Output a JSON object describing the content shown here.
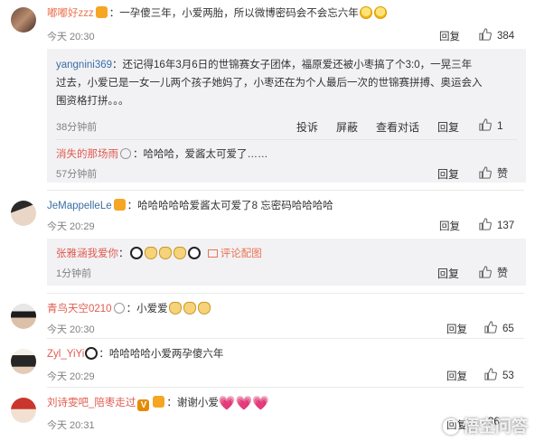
{
  "c1": {
    "user": "嘟嘟好zzz",
    "text": "：一孕傻三年，小爱两胎，所以微博密码会不会忘六年",
    "time": "今天 20:30",
    "reply": "回复",
    "likes": "384",
    "sub": {
      "r1": {
        "user": "yangnini369",
        "line1": "：还记得16年3月6日的世锦赛女子团体，福原爱还被小枣搞了个3:0，一晃三年",
        "line2": "过去，小爱已是一女一儿两个孩子她妈了，小枣还在为个人最后一次的世锦赛拼搏、奥运会入",
        "line3": "围资格打拼。。。",
        "time": "38分钟前",
        "report": "投诉",
        "block": "屏蔽",
        "view": "查看对话",
        "reply": "回复",
        "likes": "1"
      },
      "r2": {
        "user": "消失的那场雨",
        "text": "：哈哈哈，爱酱太可爱了……",
        "time": "57分钟前",
        "reply": "回复",
        "likes": "赞"
      }
    }
  },
  "c2": {
    "user": "JeMappelleLe",
    "text": "：哈哈哈哈哈爱酱太可爱了8 忘密码哈哈哈哈",
    "time": "今天 20:29",
    "reply": "回复",
    "likes": "137",
    "sub": {
      "user": "张雅涵我爱你",
      "text": "：",
      "pic": "评论配图",
      "time": "1分钟前",
      "reply": "回复",
      "likes": "赞"
    }
  },
  "c3": {
    "user": "青鸟天空0210",
    "text": "：小爱爱",
    "time": "今天 20:30",
    "reply": "回复",
    "likes": "65"
  },
  "c4": {
    "user": "Zyl_YiYi",
    "text": "：哈哈哈哈小爱两孕傻六年",
    "time": "今天 20:29",
    "reply": "回复",
    "likes": "53"
  },
  "c5": {
    "user": "刘诗雯吧_陪枣走过",
    "text": "：谢谢小爱",
    "time": "今天 20:31",
    "reply": "回复",
    "likes": "36"
  },
  "watermark": "悟空问答",
  "colors": {
    "username": "#eb7350",
    "reply_bg": "#f2f2f5",
    "divider": "#eaeaea"
  }
}
